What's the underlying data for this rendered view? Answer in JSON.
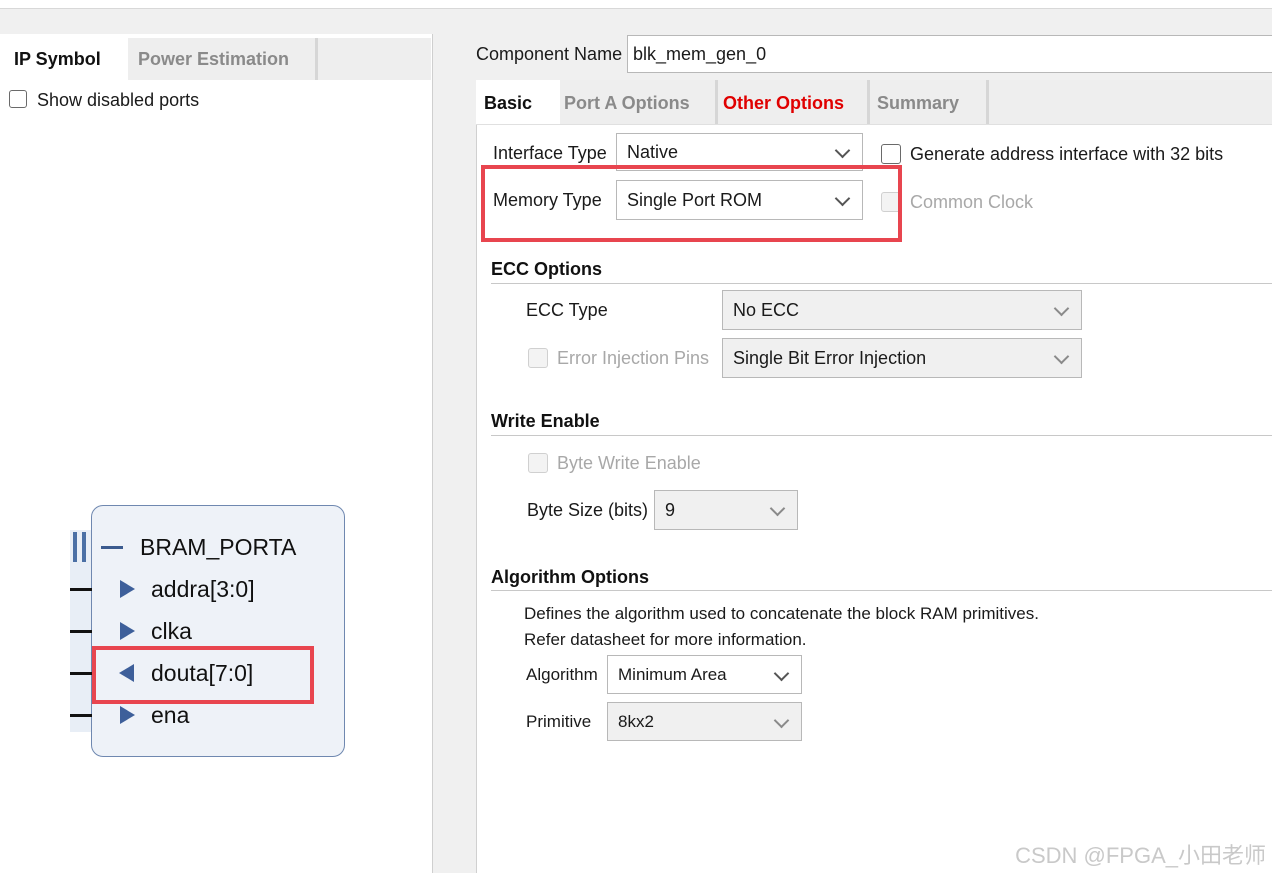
{
  "left": {
    "tabs": [
      "IP Symbol",
      "Power Estimation"
    ],
    "show_disabled_ports": "Show disabled ports",
    "symbol": {
      "bus": "BRAM_PORTA",
      "ports": [
        "addra[3:0]",
        "clka",
        "douta[7:0]",
        "ena"
      ],
      "port_directions": [
        "in",
        "in",
        "out",
        "in"
      ],
      "highlighted_port": "douta[7:0]"
    }
  },
  "component": {
    "label": "Component Name",
    "value": "blk_mem_gen_0"
  },
  "tabs": [
    "Basic",
    "Port A Options",
    "Other Options",
    "Summary"
  ],
  "active_tab": "Basic",
  "basic": {
    "interface_type_label": "Interface Type",
    "interface_type_value": "Native",
    "generate_addr_label": "Generate address interface with 32 bits",
    "memory_type_label": "Memory Type",
    "memory_type_value": "Single Port ROM",
    "common_clock_label": "Common Clock"
  },
  "ecc": {
    "title": "ECC Options",
    "type_label": "ECC Type",
    "type_value": "No ECC",
    "error_injection_label": "Error Injection Pins",
    "error_injection_value": "Single Bit Error Injection"
  },
  "write_enable": {
    "title": "Write Enable",
    "byte_write_label": "Byte Write Enable",
    "byte_size_label": "Byte Size (bits)",
    "byte_size_value": "9"
  },
  "algorithm": {
    "title": "Algorithm Options",
    "desc1": "Defines the algorithm used to concatenate the block RAM primitives.",
    "desc2": "Refer datasheet for more information.",
    "algorithm_label": "Algorithm",
    "algorithm_value": "Minimum Area",
    "primitive_label": "Primitive",
    "primitive_value": "8kx2"
  },
  "watermark": "CSDN @FPGA_小田老师",
  "colors": {
    "highlight": "#e8454f",
    "other_options_tab": "#e00000",
    "symbol_blue": "#3d5f9a"
  }
}
